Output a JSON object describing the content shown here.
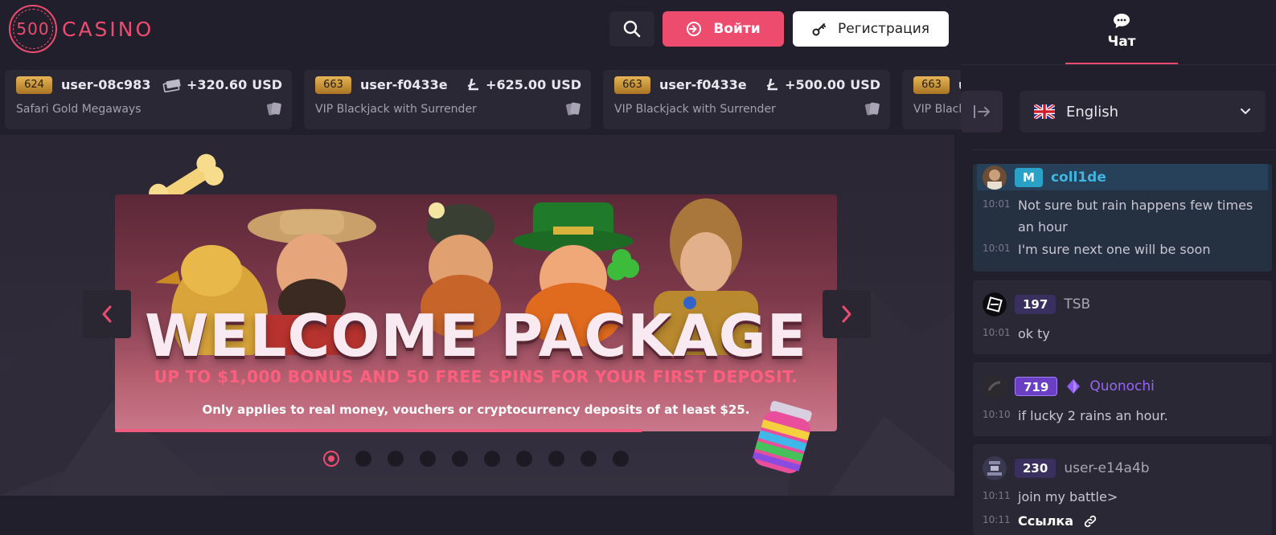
{
  "header": {
    "logo_number": "500",
    "logo_text": "CASINO",
    "login_label": "Войти",
    "register_label": "Регистрация"
  },
  "ticker": [
    {
      "level": "624",
      "user": "user-08c983",
      "amount": "+320.60",
      "currency": "USD",
      "game": "Safari Gold Megaways",
      "coin_icon": "cash-stack-icon"
    },
    {
      "level": "663",
      "user": "user-f0433e",
      "amount": "+625.00",
      "currency": "USD",
      "game": "VIP Blackjack with Surrender",
      "coin_icon": "litecoin-icon"
    },
    {
      "level": "663",
      "user": "user-f0433e",
      "amount": "+500.00",
      "currency": "USD",
      "game": "VIP Blackjack with Surrender",
      "coin_icon": "litecoin-icon"
    },
    {
      "level": "663",
      "user": "u",
      "amount": "",
      "currency": "",
      "game": "VIP Black",
      "coin_icon": ""
    }
  ],
  "banner": {
    "title": "WELCOME PACKAGE",
    "subtitle": "UP TO $1,000 BONUS AND 50 FREE SPINS FOR YOUR FIRST DEPOSIT.",
    "note": "Only applies to real money, vouchers or cryptocurrency deposits of at least $25.",
    "slide_count": 10,
    "active_slide": 1,
    "progress": 0.73
  },
  "chat": {
    "tab_label": "Чат",
    "language": "English",
    "messages": [
      {
        "user": "coll1de",
        "level": "M",
        "level_color": "#2aa1c7",
        "name_color": "#3fb6e0",
        "lines": [
          {
            "time": "10:01",
            "text": "Not sure but rain happens few times an hour"
          },
          {
            "time": "10:01",
            "text": "I'm sure next one will be soon"
          }
        ]
      },
      {
        "user": "TSB",
        "level": "197",
        "level_color": "#3a3060",
        "name_color": "#a9a5b5",
        "lines": [
          {
            "time": "10:01",
            "text": "ok ty"
          }
        ]
      },
      {
        "user": "Quonochi",
        "level": "719",
        "level_color": "#6a3fc4",
        "name_color": "#9466f0",
        "lines": [
          {
            "time": "10:10",
            "text": "if lucky 2 rains an hour."
          }
        ]
      },
      {
        "user": "user-e14a4b",
        "level": "230",
        "level_color": "#3a3060",
        "name_color": "#a9a5b5",
        "lines": [
          {
            "time": "10:11",
            "text": "join my battle>"
          },
          {
            "time": "10:11",
            "text": "Ссылка"
          }
        ]
      }
    ]
  },
  "colors": {
    "accent": "#ee4c6f",
    "background": "#221f2c",
    "panel": "#2b2835"
  }
}
